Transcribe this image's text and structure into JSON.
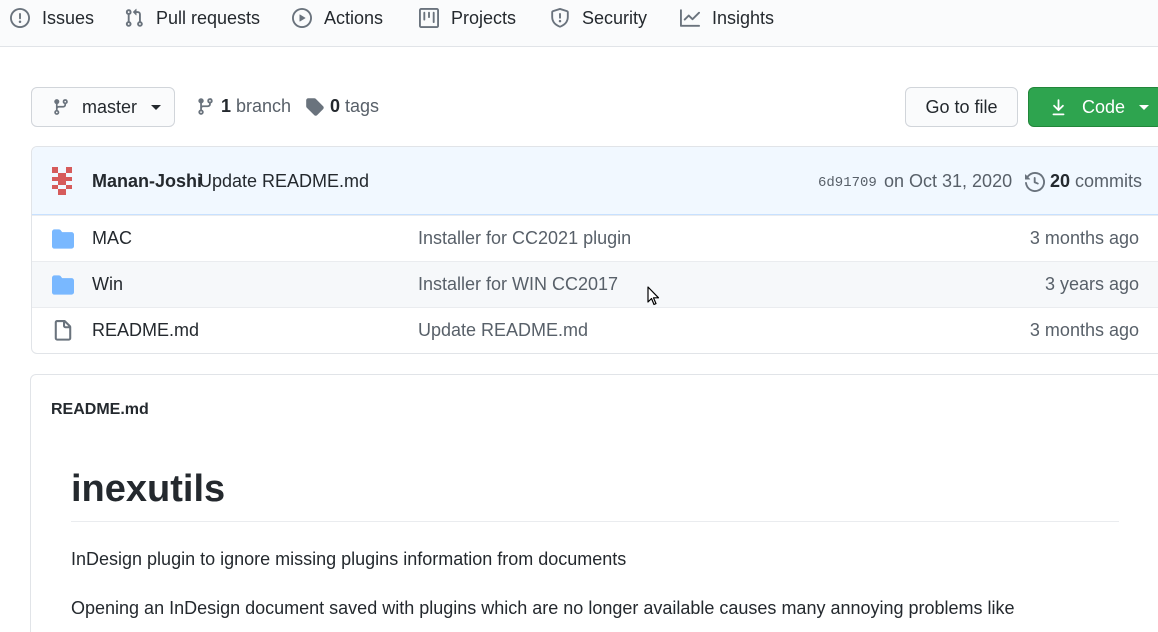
{
  "tabs": [
    {
      "label": "Issues",
      "icon": "issue-icon"
    },
    {
      "label": "Pull requests",
      "icon": "pull-request-icon"
    },
    {
      "label": "Actions",
      "icon": "play-icon"
    },
    {
      "label": "Projects",
      "icon": "project-icon"
    },
    {
      "label": "Security",
      "icon": "shield-icon"
    },
    {
      "label": "Insights",
      "icon": "graph-icon"
    }
  ],
  "branch": {
    "selected": "master",
    "branch_count": "1",
    "branch_label": "branch",
    "tag_count": "0",
    "tag_label": "tags"
  },
  "buttons": {
    "goto_file": "Go to file",
    "code": "Code"
  },
  "commit": {
    "author": "Manan-Joshi",
    "message": "Update README.md",
    "sha": "6d91709",
    "date": "on Oct 31, 2020",
    "commit_count": "20",
    "commit_label": "commits"
  },
  "files": [
    {
      "name": "MAC",
      "type": "folder",
      "commit": "Installer for CC2021 plugin",
      "age": "3 months ago"
    },
    {
      "name": "Win",
      "type": "folder",
      "commit": "Installer for WIN CC2017",
      "age": "3 years ago"
    },
    {
      "name": "README.md",
      "type": "file",
      "commit": "Update README.md",
      "age": "3 months ago"
    }
  ],
  "readme": {
    "filename": "README.md",
    "title": "inexutils",
    "paragraph1": "InDesign plugin to ignore missing plugins information from documents",
    "paragraph2": "Opening an InDesign document saved with plugins which are no longer available causes many annoying problems like"
  },
  "colors": {
    "code_button": "#2ea44f",
    "folder": "#79b8ff",
    "commit_bg": "#f1f8ff"
  }
}
